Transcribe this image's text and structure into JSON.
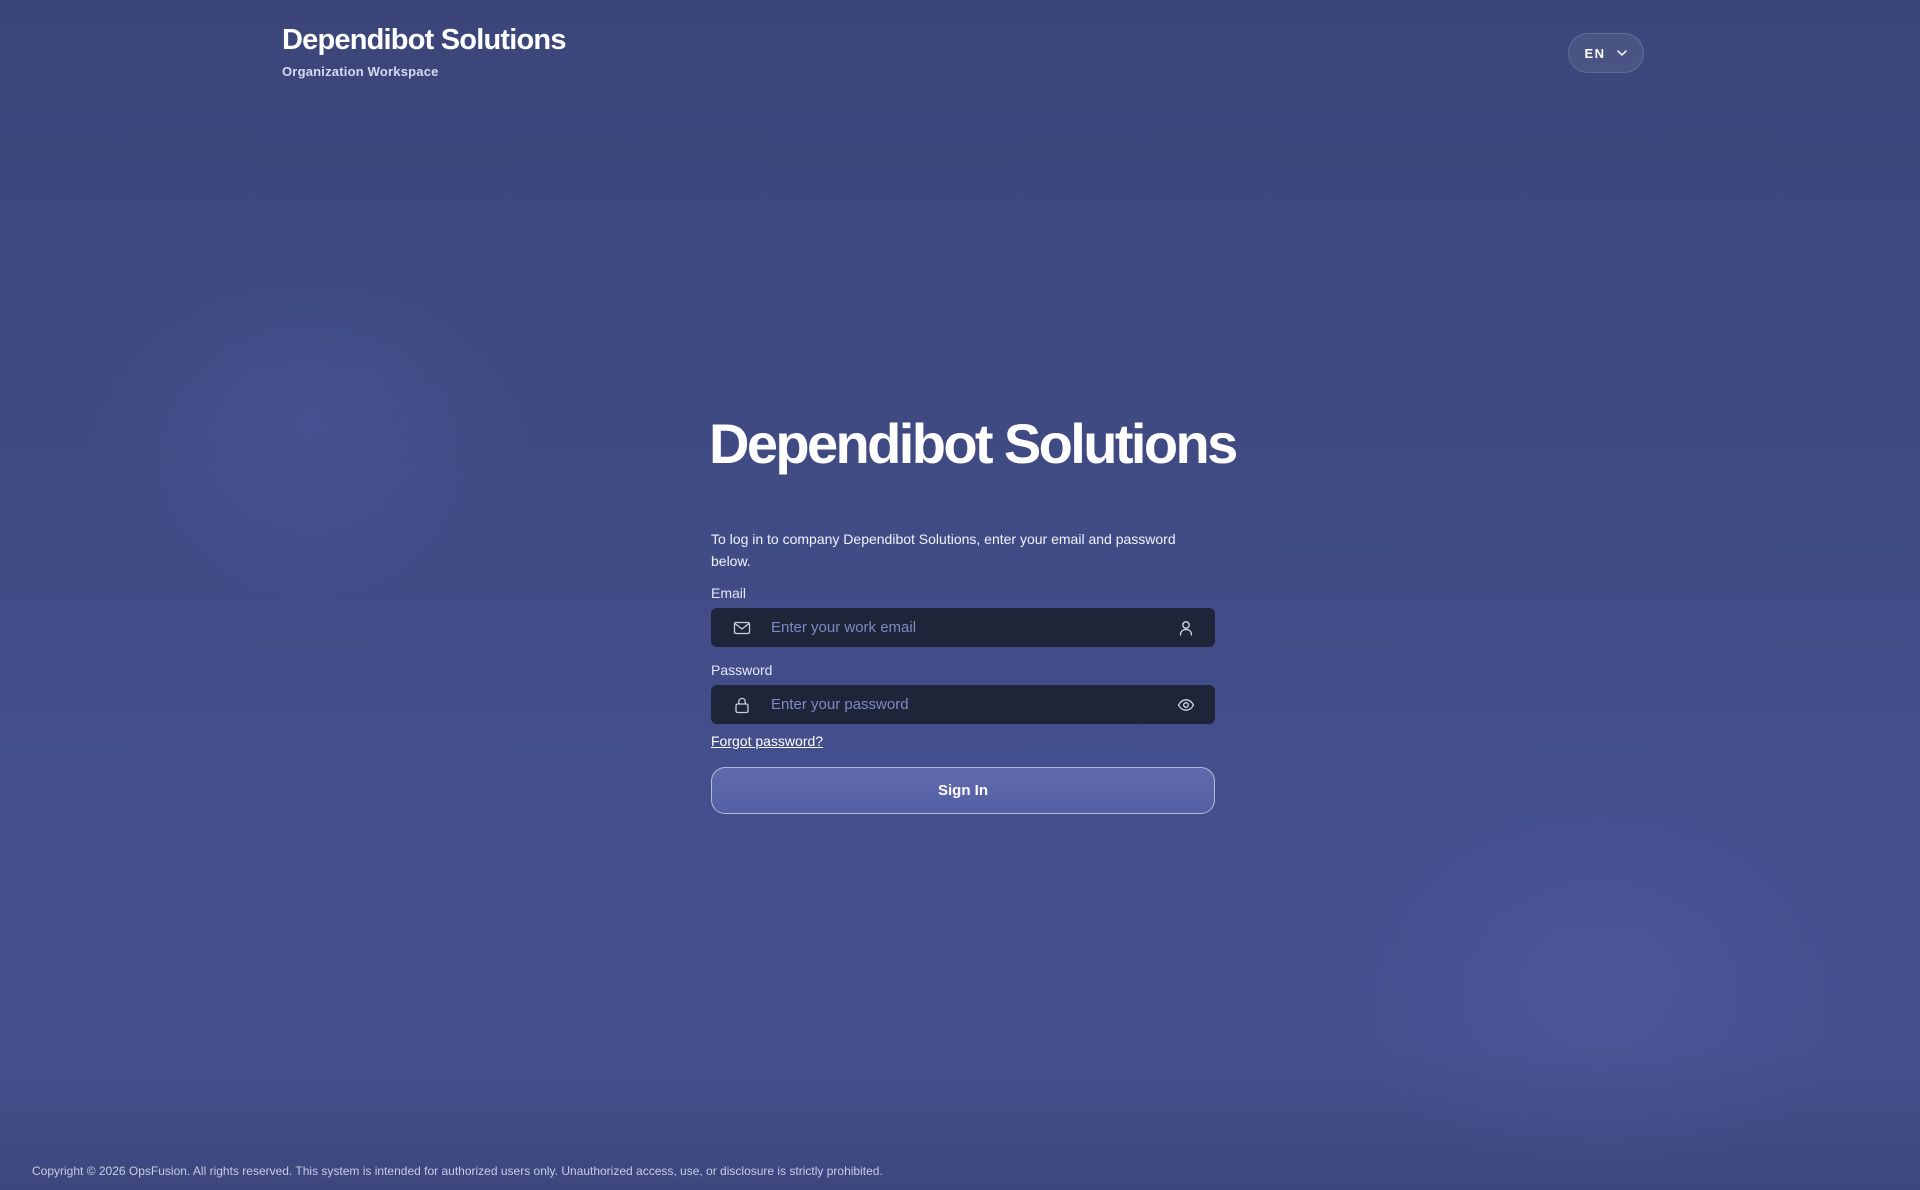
{
  "header": {
    "brand_title": "Dependibot Solutions",
    "brand_subtitle": "Organization Workspace",
    "language": "EN"
  },
  "login": {
    "title": "Dependibot Solutions",
    "description": "To log in to company Dependibot Solutions, enter your email and password below.",
    "email_label": "Email",
    "email_placeholder": "Enter your work email",
    "email_value": "",
    "password_label": "Password",
    "password_placeholder": "Enter your password",
    "password_value": "",
    "forgot_password": "Forgot password?",
    "sign_in": "Sign In"
  },
  "footer": {
    "copyright": "Copyright © 2026 OpsFusion. All rights reserved. This system is intended for authorized users only. Unauthorized access, use, or disclosure is strictly prohibited."
  },
  "colors": {
    "background": "#3f4a82",
    "input_background": "#1f2538",
    "placeholder": "#7d8ac4"
  },
  "icons": {
    "email_field": "mail-icon",
    "email_trailing": "user-icon",
    "password_field": "lock-icon",
    "password_trailing": "eye-icon",
    "language_dropdown": "chevron-down-icon"
  }
}
